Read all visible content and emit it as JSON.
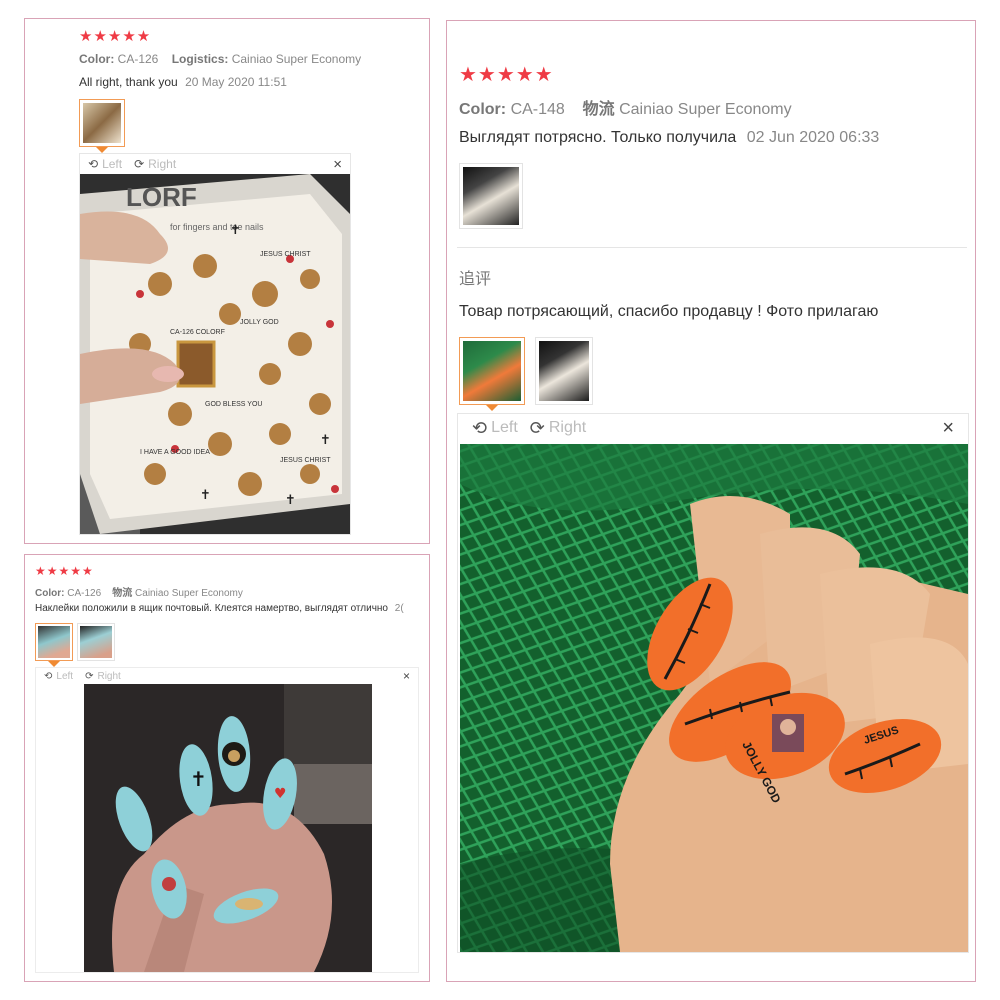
{
  "colors": {
    "border": "#d9a3b6",
    "stars": "#ef3b45",
    "selected": "#f08a33"
  },
  "review1": {
    "stars": "★★★★★",
    "color_label": "Color:",
    "color_value": "CA-126",
    "logistics_label": "Logistics:",
    "logistics_value": "Cainiao Super Economy",
    "text": "All right, thank you",
    "date": "20 May 2020 11:51",
    "viewer": {
      "left": "Left",
      "right": "Right",
      "close": "×"
    },
    "photo_labels": {
      "brand": "LORF",
      "subtitle": "for fingers and toe nails",
      "code": "CA-126 COLORF",
      "lines": [
        "JESUS CHRIST",
        "JOLLY GOD",
        "I HAVE A GOOD IDEA",
        "GOD BLESS YOU",
        "I HAVE A GOOD IDEA"
      ]
    }
  },
  "review2": {
    "stars": "★★★★★",
    "color_label": "Color:",
    "color_value": "CA-148",
    "logistics_label": "物流",
    "logistics_value": "Cainiao Super Economy",
    "text": "Выглядят потрясно. Только получила",
    "date": "02 Jun 2020 06:33",
    "followup_label": "追评",
    "followup_text": "Товар потрясающий, спасибо продавцу ! Фото прилагаю",
    "viewer": {
      "left": "Left",
      "right": "Right",
      "close": "×"
    },
    "photo_labels": {
      "nail_text_1": "JOLLY GOD",
      "nail_text_2": "JESUS"
    }
  },
  "review3": {
    "stars": "★★★★★",
    "color_label": "Color:",
    "color_value": "CA-126",
    "logistics_label": "物流",
    "logistics_value": "Cainiao Super Economy",
    "text": "Наклейки положили в ящик почтовый. Клеятся намертво, выглядят отлично",
    "date_fragment": "2(",
    "viewer": {
      "left": "Left",
      "right": "Right",
      "close": "×"
    }
  }
}
